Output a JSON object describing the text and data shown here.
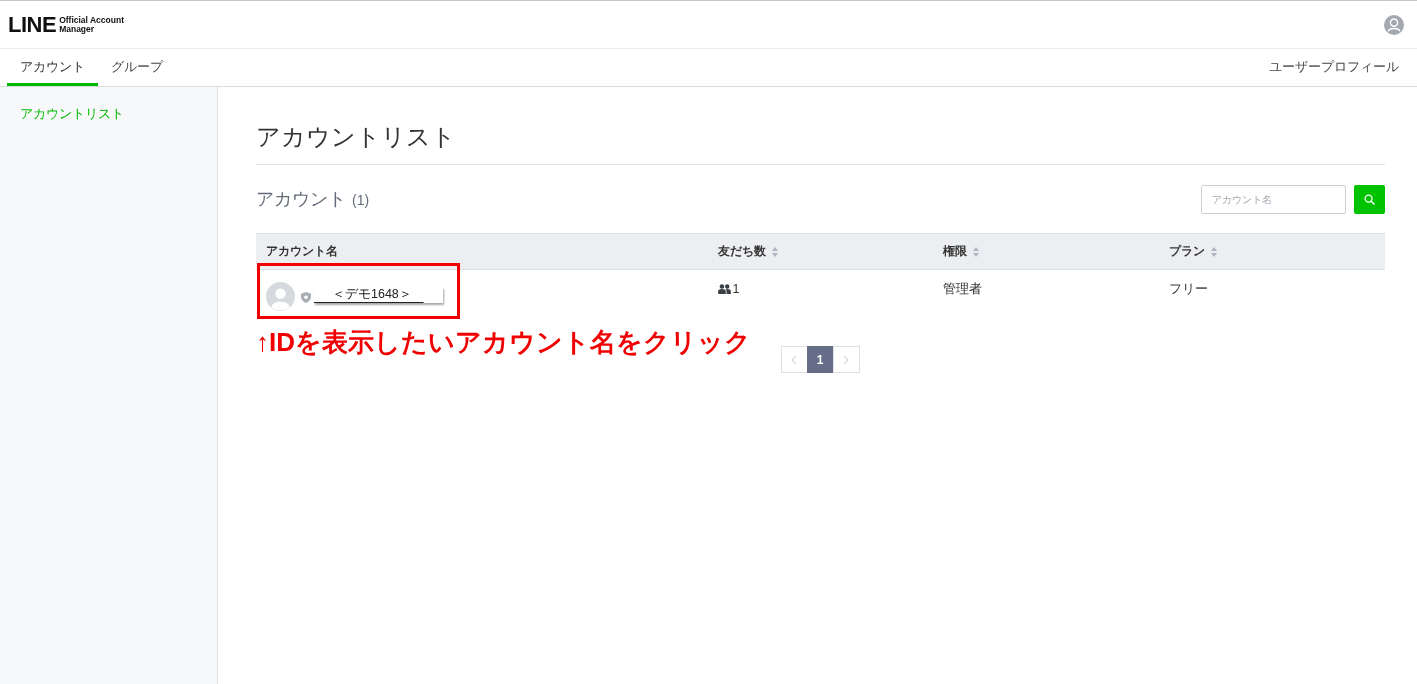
{
  "header": {
    "logo": {
      "wordmark": "LINE",
      "line_1": "Official Account",
      "line_2": "Manager"
    }
  },
  "tabs": [
    {
      "label": "アカウント",
      "selected": true
    },
    {
      "label": "グループ",
      "selected": false
    }
  ],
  "profile_link": "ユーザープロフィール",
  "sidebar": {
    "items": [
      {
        "label": "アカウントリスト",
        "selected": true
      }
    ]
  },
  "page_title": "アカウントリスト",
  "section": {
    "title": "アカウント",
    "count": "(1)"
  },
  "search": {
    "placeholder": "アカウント名"
  },
  "table": {
    "columns": [
      {
        "label": "アカウント名",
        "sortable": false
      },
      {
        "label": "友だち数",
        "sortable": true
      },
      {
        "label": "権限",
        "sortable": true
      },
      {
        "label": "プラン",
        "sortable": true
      }
    ],
    "rows": [
      {
        "account_name": "＜デモ1648＞",
        "friends": "1",
        "role": "管理者",
        "plan": "フリー"
      }
    ]
  },
  "pagination": {
    "prev": {
      "disabled": true
    },
    "pages": [
      {
        "label": "1",
        "selected": true
      }
    ],
    "next": {
      "disabled": true
    }
  },
  "annotation": {
    "text": "↑IDを表示したいアカウント名をクリック"
  }
}
